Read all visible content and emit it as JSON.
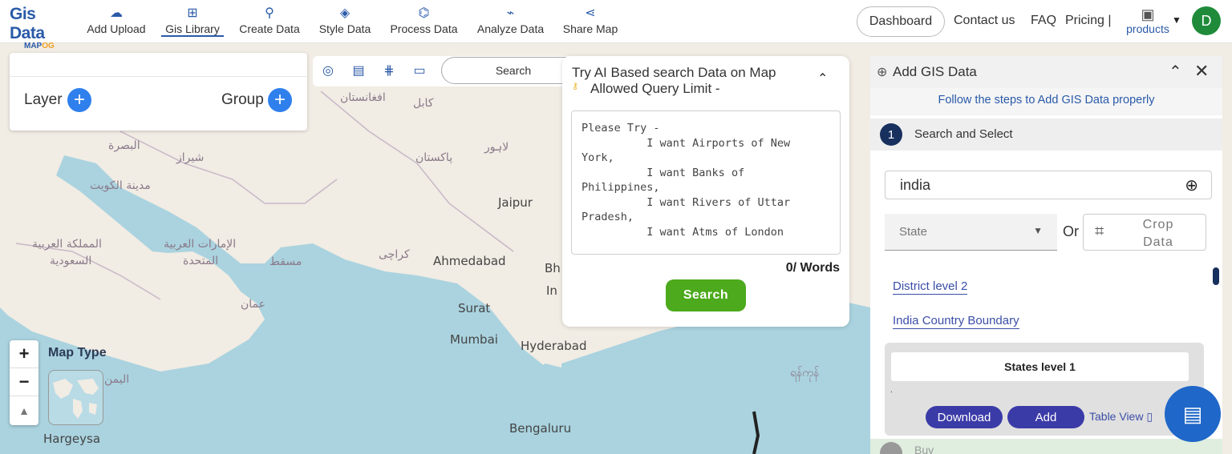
{
  "logo": {
    "line1": "Gis Data",
    "line2a": "MAP",
    "line2b": "OG"
  },
  "nav": [
    {
      "label": "Add Upload",
      "icon": "cloud-upload-icon",
      "glyph": "☁"
    },
    {
      "label": "Gis Library",
      "icon": "library-add-icon",
      "glyph": "⊞"
    },
    {
      "label": "Create Data",
      "icon": "map-pin-icon",
      "glyph": "⚲"
    },
    {
      "label": "Style Data",
      "icon": "paint-bucket-icon",
      "glyph": "◈"
    },
    {
      "label": "Process Data",
      "icon": "process-icon",
      "glyph": "⌬"
    },
    {
      "label": "Analyze Data",
      "icon": "analyze-icon",
      "glyph": "⌁"
    },
    {
      "label": "Share Map",
      "icon": "share-icon",
      "glyph": "⋖"
    }
  ],
  "top_right": {
    "dashboard": "Dashboard",
    "contact": "Contact us",
    "faq": "FAQ",
    "pricing": "Pricing |",
    "products": "products",
    "avatar_letter": "D"
  },
  "layer_panel": {
    "layer": "Layer",
    "group": "Group"
  },
  "toolbar": {
    "search_label": "Search"
  },
  "ai_panel": {
    "title": "Try AI Based search Data on Map",
    "subtitle": "Allowed Query Limit -",
    "placeholder_text": "Please Try -\n          I want Airports of New\nYork,\n          I want Banks of\nPhilippines,\n          I want Rivers of Uttar\nPradesh,\n          I want Atms of London",
    "word_count": "0/ Words",
    "search_button": "Search"
  },
  "map_type": {
    "label": "Map Type"
  },
  "map_labels": {
    "kuwait": "مدينة الكويت",
    "basra": "البصرة",
    "shiraz": "شيراز",
    "saudi1": "المملكة العربية",
    "saudi2": "السعودية",
    "uae1": "الإمارات العربية",
    "uae2": "المتحدة",
    "muscat": "مسقط",
    "oman": "عمان",
    "yemen": "اليمن",
    "afghanistan": "افغانستان",
    "kabul": "کابل",
    "pakistan": "پاکستان",
    "lahore": "لاہور",
    "karachi": "کراچی",
    "jaipur": "Jaipur",
    "ahmedabad": "Ahmedabad",
    "surat": "Surat",
    "mumbai": "Mumbai",
    "hyderabad": "Hyderabad",
    "bengaluru": "Bengaluru",
    "hargeysa": "Hargeysa",
    "bh": "Bh",
    "in": "In",
    "myanmar": "ရန်ကုန်"
  },
  "right_panel": {
    "title": "Add GIS Data",
    "hint": "Follow the steps to Add GIS Data properly",
    "step_number": "1",
    "step_label": "Search and Select",
    "search_value": "india",
    "select_value": "State",
    "or_label": "Or",
    "crop_label": "Crop Data",
    "links": [
      "District level 2",
      "India Country Boundary"
    ],
    "card_title": "States level 1",
    "card_dot": ".",
    "download_button": "Download",
    "add_button": "Add",
    "table_view": "Table View",
    "next_step_label": "Buy"
  },
  "colors": {
    "brand": "#2a5aa8",
    "green_button": "#4caa1c",
    "pill_button": "#3b3ba8",
    "avatar": "#1f8b3a",
    "water": "#aad3df",
    "land": "#f1ece4"
  }
}
